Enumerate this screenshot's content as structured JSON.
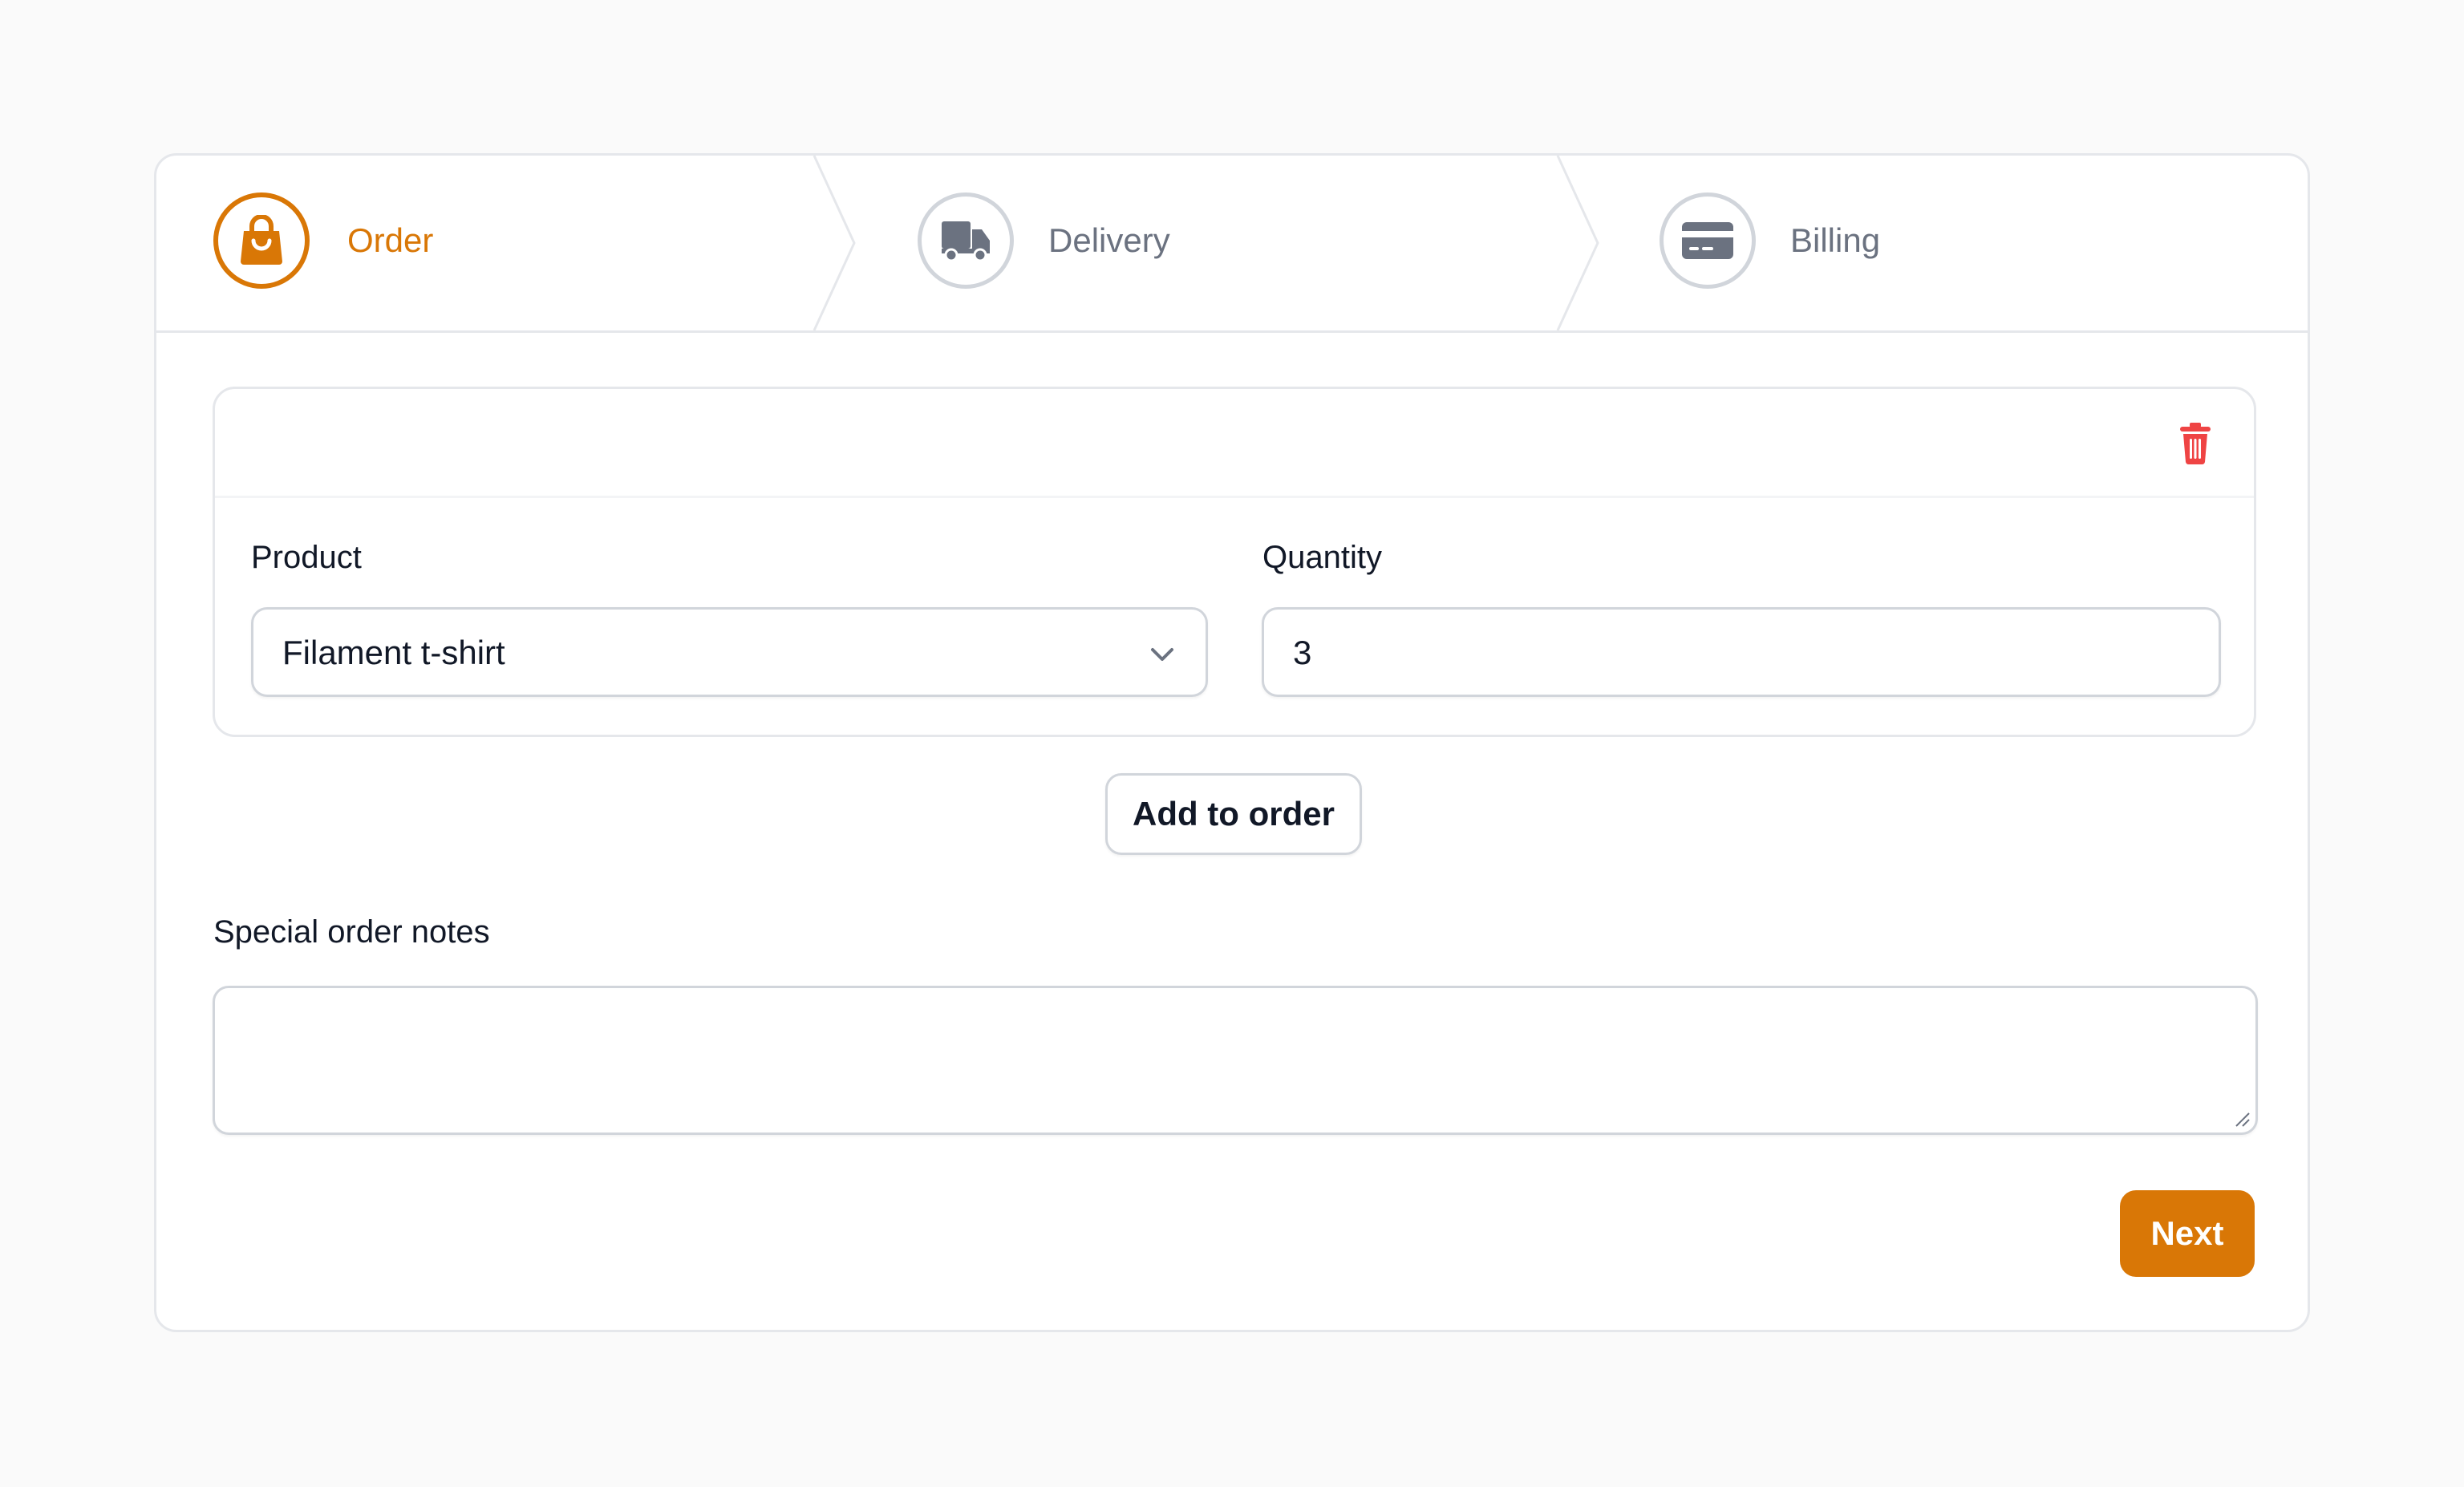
{
  "steps": [
    {
      "label": "Order",
      "icon": "shopping-bag-icon",
      "state": "active"
    },
    {
      "label": "Delivery",
      "icon": "truck-icon",
      "state": "inactive"
    },
    {
      "label": "Billing",
      "icon": "credit-card-icon",
      "state": "inactive"
    }
  ],
  "item": {
    "product_label": "Product",
    "product_value": "Filament t-shirt",
    "quantity_label": "Quantity",
    "quantity_value": "3"
  },
  "actions": {
    "add_label": "Add to order",
    "next_label": "Next"
  },
  "notes": {
    "label": "Special order notes",
    "value": ""
  },
  "colors": {
    "accent": "#d97706",
    "danger": "#ef4444",
    "muted": "#6b7280",
    "border": "#d1d5db"
  }
}
